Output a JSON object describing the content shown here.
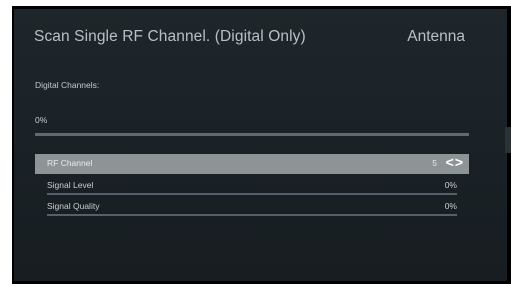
{
  "header": {
    "title": "Scan Single RF Channel. (Digital Only)",
    "source": "Antenna"
  },
  "section_label": "Digital Channels:",
  "progress": {
    "text": "0%",
    "value": 0
  },
  "rows": [
    {
      "label": "RF Channel",
      "value": "5",
      "arrows": "<>"
    },
    {
      "label": "Signal Level",
      "value": "0%"
    },
    {
      "label": "Signal Quality",
      "value": "0%"
    }
  ]
}
